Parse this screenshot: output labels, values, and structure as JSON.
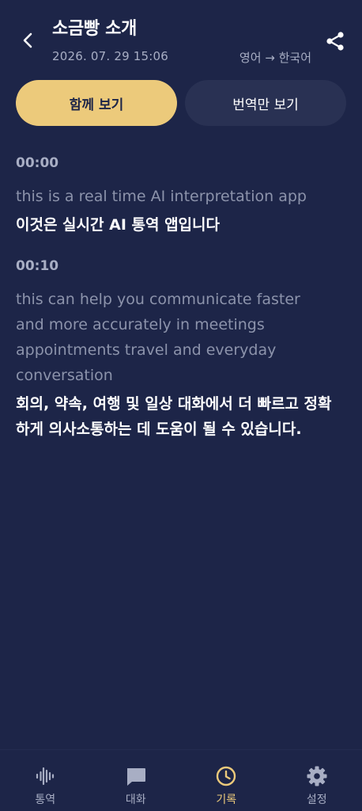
{
  "header": {
    "title": "소금빵 소개",
    "timestamp": "2026. 07. 29 15:06",
    "language_pair": "영어 → 한국어"
  },
  "view_toggle": {
    "both_label": "함께 보기",
    "translation_only_label": "번역만 보기",
    "active": "both"
  },
  "transcript": [
    {
      "time": "00:00",
      "source": "this is a real time AI interpretation app",
      "target": "이것은 실시간 AI 통역 앱입니다"
    },
    {
      "time": "00:10",
      "source": "this can help you communicate faster and more accurately in meetings appointments travel and everyday conversation",
      "target": "회의, 약속, 여행 및 일상 대화에서 더 빠르고 정확하게 의사소통하는 데 도움이 될 수 있습니다."
    }
  ],
  "bottom_nav": {
    "items": [
      {
        "label": "통역",
        "icon": "waveform-icon"
      },
      {
        "label": "대화",
        "icon": "chat-bubble-icon"
      },
      {
        "label": "기록",
        "icon": "clock-icon"
      },
      {
        "label": "설정",
        "icon": "gear-icon"
      }
    ],
    "active_index": 2
  },
  "colors": {
    "background": "#1d2548",
    "accent": "#ecca7b",
    "muted_text": "#8c93ab",
    "inactive_button": "#293153"
  }
}
